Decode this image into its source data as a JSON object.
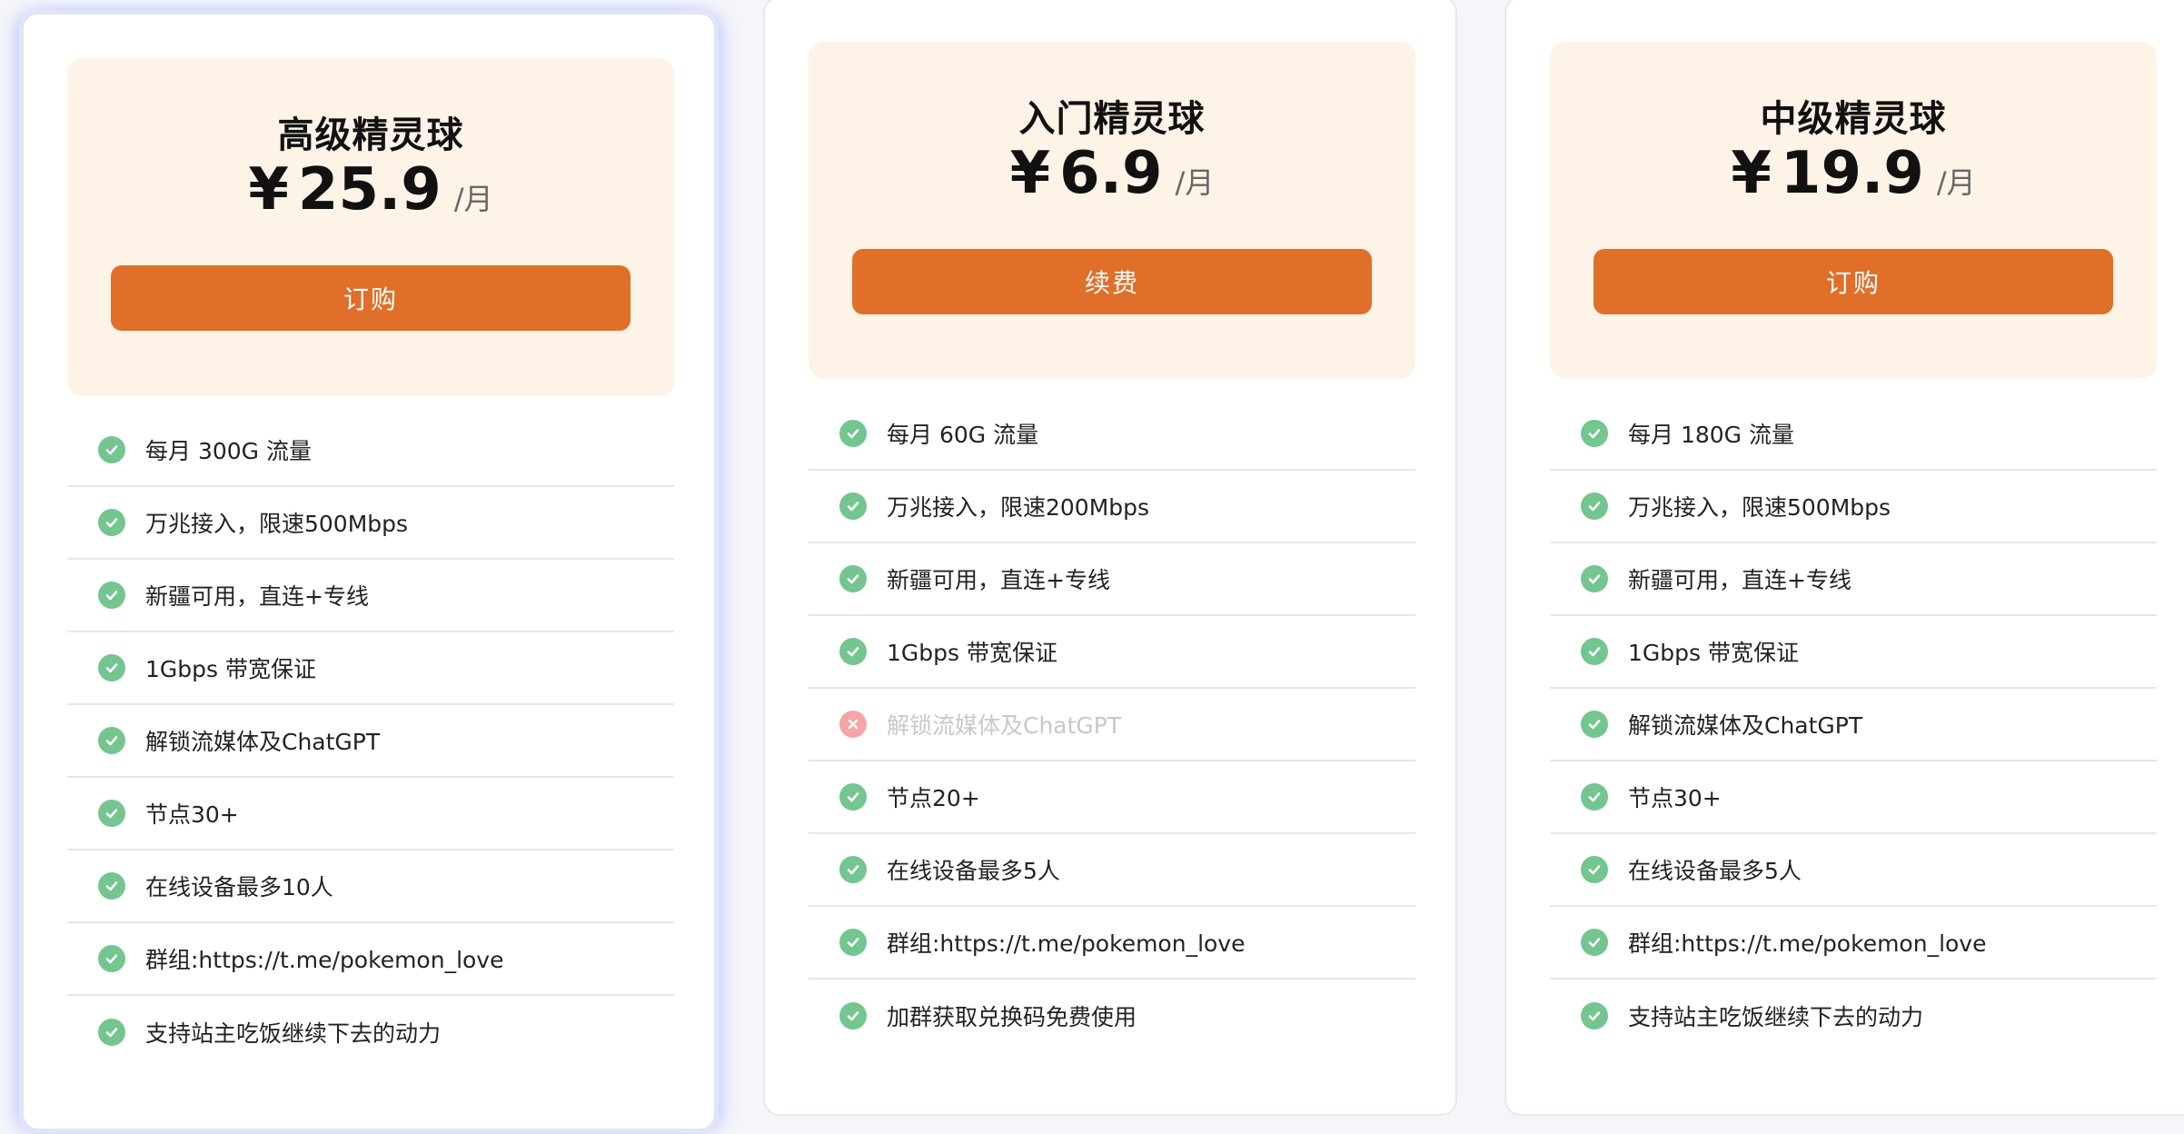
{
  "colors": {
    "accent": "#e06f2a",
    "header_bg": "#fdf3e6",
    "check": "#74c58f",
    "cross": "#f4a6a6"
  },
  "plans": [
    {
      "name": "高级精灵球",
      "currency": "¥",
      "price": "25.9",
      "period": "/月",
      "button_label": "订购",
      "features": [
        {
          "text": "每月 300G 流量",
          "included": true,
          "icon": "check-circle-icon"
        },
        {
          "text": "万兆接入，限速500Mbps",
          "included": true,
          "icon": "check-circle-icon"
        },
        {
          "text": "新疆可用，直连+专线",
          "included": true,
          "icon": "check-circle-icon"
        },
        {
          "text": "1Gbps 带宽保证",
          "included": true,
          "icon": "check-circle-icon"
        },
        {
          "text": "解锁流媒体及ChatGPT",
          "included": true,
          "icon": "check-circle-icon"
        },
        {
          "text": "节点30+",
          "included": true,
          "icon": "check-circle-icon"
        },
        {
          "text": "在线设备最多10人",
          "included": true,
          "icon": "check-circle-icon"
        },
        {
          "text": "群组:https://t.me/pokemon_love",
          "included": true,
          "icon": "check-circle-icon"
        },
        {
          "text": "支持站主吃饭继续下去的动力",
          "included": true,
          "icon": "check-circle-icon"
        }
      ]
    },
    {
      "name": "入门精灵球",
      "currency": "¥",
      "price": "6.9",
      "period": "/月",
      "button_label": "续费",
      "features": [
        {
          "text": "每月 60G 流量",
          "included": true,
          "icon": "check-circle-icon"
        },
        {
          "text": "万兆接入，限速200Mbps",
          "included": true,
          "icon": "check-circle-icon"
        },
        {
          "text": "新疆可用，直连+专线",
          "included": true,
          "icon": "check-circle-icon"
        },
        {
          "text": "1Gbps 带宽保证",
          "included": true,
          "icon": "check-circle-icon"
        },
        {
          "text": "解锁流媒体及ChatGPT",
          "included": false,
          "icon": "cross-circle-icon"
        },
        {
          "text": "节点20+",
          "included": true,
          "icon": "check-circle-icon"
        },
        {
          "text": "在线设备最多5人",
          "included": true,
          "icon": "check-circle-icon"
        },
        {
          "text": "群组:https://t.me/pokemon_love",
          "included": true,
          "icon": "check-circle-icon"
        },
        {
          "text": "加群获取兑换码免费使用",
          "included": true,
          "icon": "check-circle-icon"
        }
      ]
    },
    {
      "name": "中级精灵球",
      "currency": "¥",
      "price": "19.9",
      "period": "/月",
      "button_label": "订购",
      "features": [
        {
          "text": "每月 180G 流量",
          "included": true,
          "icon": "check-circle-icon"
        },
        {
          "text": "万兆接入，限速500Mbps",
          "included": true,
          "icon": "check-circle-icon"
        },
        {
          "text": "新疆可用，直连+专线",
          "included": true,
          "icon": "check-circle-icon"
        },
        {
          "text": "1Gbps 带宽保证",
          "included": true,
          "icon": "check-circle-icon"
        },
        {
          "text": "解锁流媒体及ChatGPT",
          "included": true,
          "icon": "check-circle-icon"
        },
        {
          "text": "节点30+",
          "included": true,
          "icon": "check-circle-icon"
        },
        {
          "text": "在线设备最多5人",
          "included": true,
          "icon": "check-circle-icon"
        },
        {
          "text": "群组:https://t.me/pokemon_love",
          "included": true,
          "icon": "check-circle-icon"
        },
        {
          "text": "支持站主吃饭继续下去的动力",
          "included": true,
          "icon": "check-circle-icon"
        }
      ]
    }
  ]
}
